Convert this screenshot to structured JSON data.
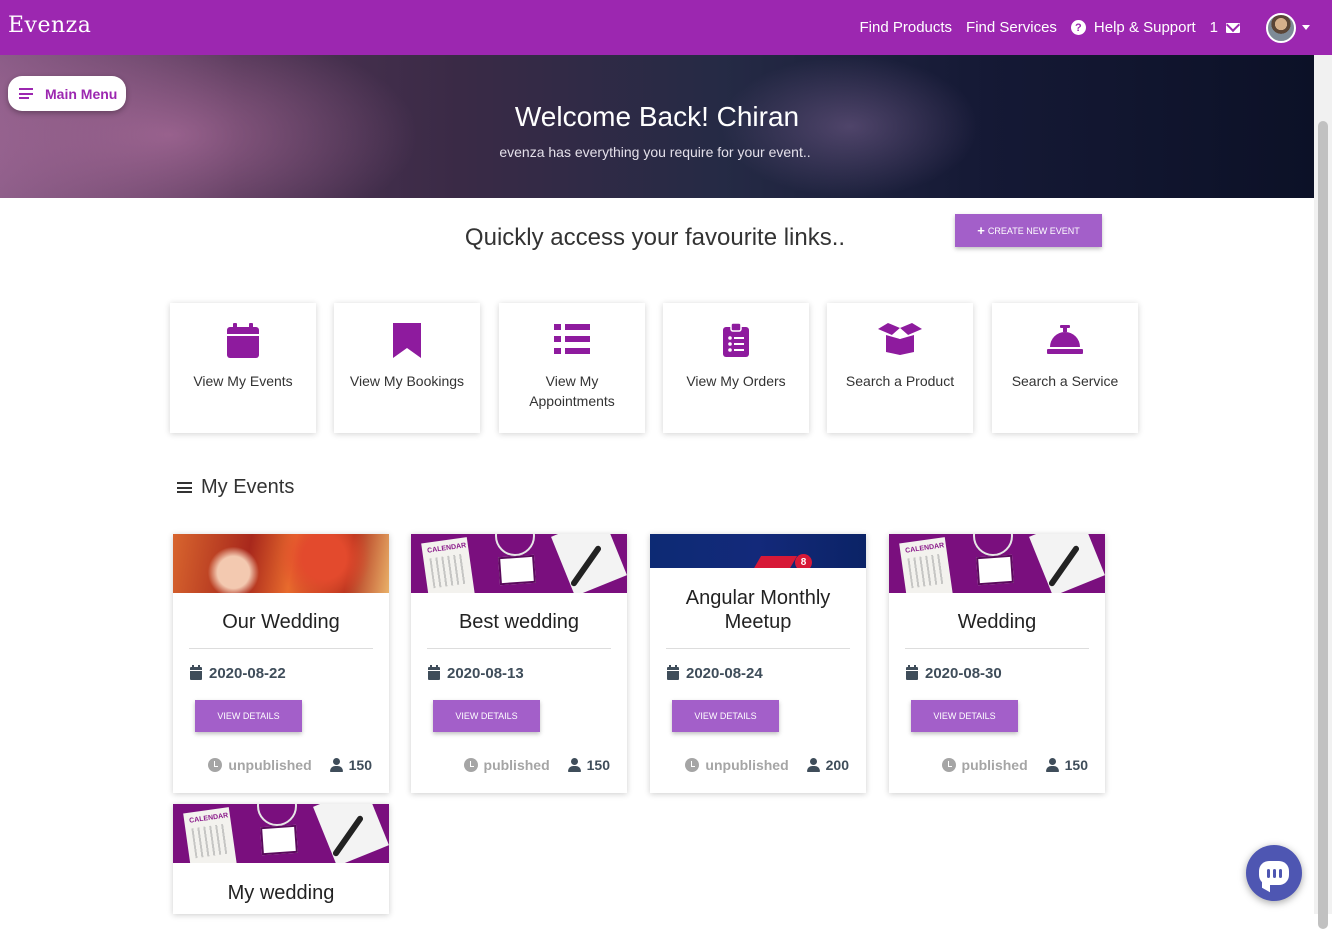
{
  "app": {
    "brand": "Evenza"
  },
  "nav": {
    "find_products": "Find Products",
    "find_services": "Find Services",
    "help_support": "Help & Support",
    "messages_count": "1"
  },
  "hero": {
    "title": "Welcome Back! Chiran",
    "subtitle": "evenza has everything you require for your event.."
  },
  "main_menu": {
    "label": "Main Menu"
  },
  "quick_links": {
    "title": "Quickly access your favourite links..",
    "create_button": "CREATE NEW EVENT",
    "tiles": [
      {
        "label": "View My Events",
        "icon": "calendar-icon"
      },
      {
        "label": "View My Bookings",
        "icon": "bookmark-icon"
      },
      {
        "label": "View My Appointments",
        "icon": "list-icon"
      },
      {
        "label": "View My Orders",
        "icon": "clipboard-list-icon"
      },
      {
        "label": "Search a Product",
        "icon": "box-open-icon"
      },
      {
        "label": "Search a Service",
        "icon": "concierge-bell-icon"
      }
    ]
  },
  "events_section": {
    "title": "My Events",
    "events": [
      {
        "title": "Our Wedding",
        "date": "2020-08-22",
        "button": "VIEW DETAILS",
        "status": "unpublished",
        "guests": "150"
      },
      {
        "title": "Best wedding",
        "date": "2020-08-13",
        "button": "VIEW DETAILS",
        "status": "published",
        "guests": "150"
      },
      {
        "title": "Angular Monthly Meetup",
        "date": "2020-08-24",
        "button": "VIEW DETAILS",
        "status": "unpublished",
        "guests": "200",
        "image_badge": "8"
      },
      {
        "title": "Wedding",
        "date": "2020-08-30",
        "button": "VIEW DETAILS",
        "status": "published",
        "guests": "150"
      },
      {
        "title": "My wedding"
      }
    ]
  },
  "colors": {
    "primary": "#9c27b0",
    "button": "#a35fc9",
    "chat": "#4e56b2"
  }
}
